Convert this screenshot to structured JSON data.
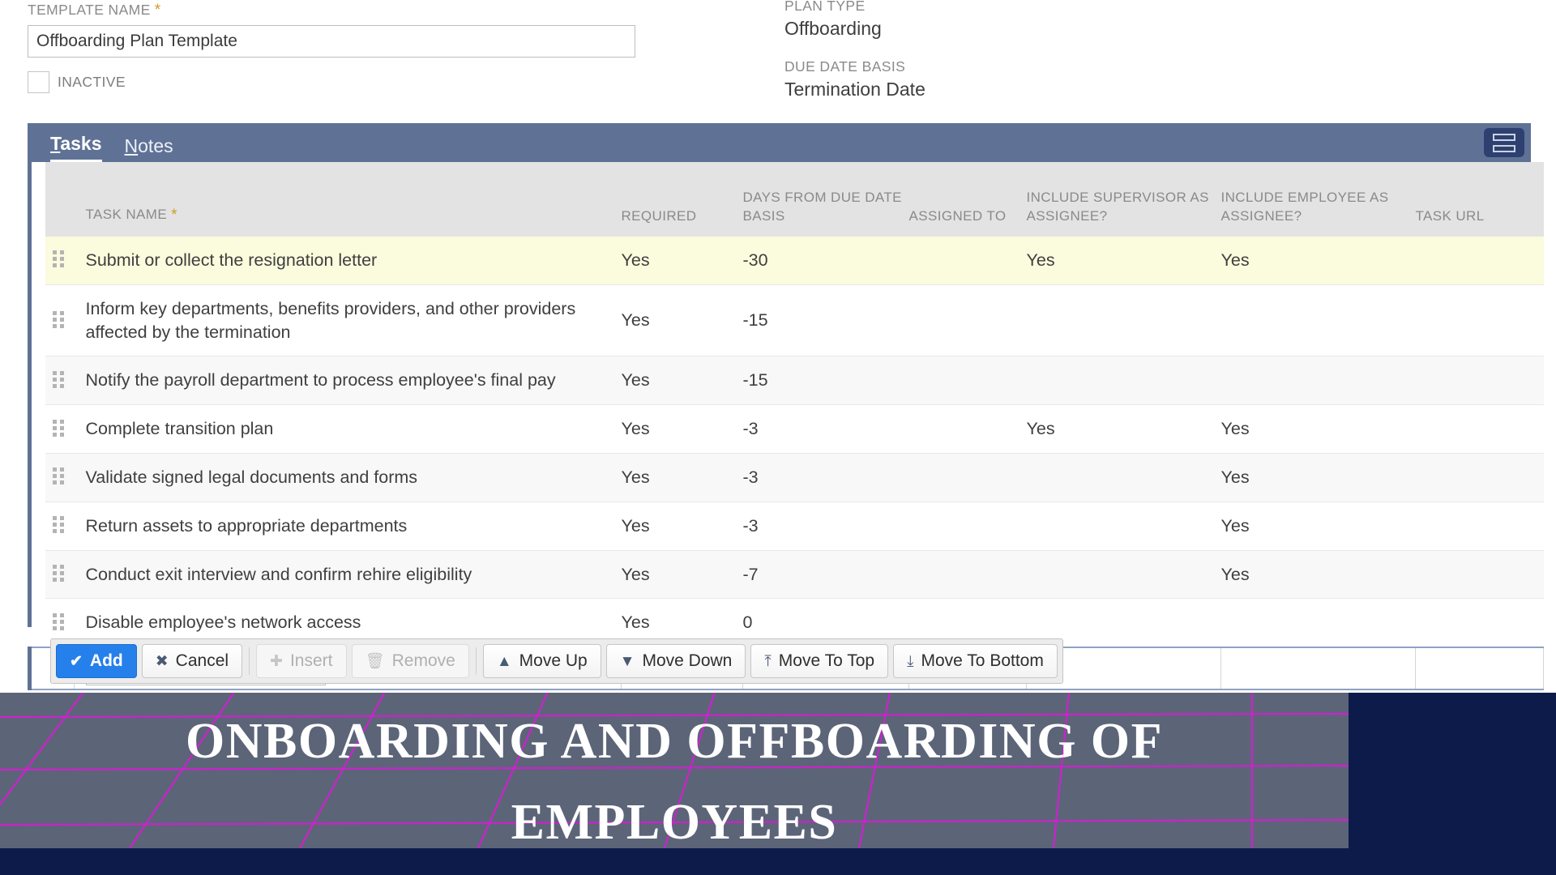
{
  "form": {
    "template_name": {
      "label": "TEMPLATE NAME",
      "required_marker": "*",
      "value": "Offboarding Plan Template",
      "placeholder": ""
    },
    "inactive": {
      "label": "INACTIVE",
      "checked": false
    },
    "plan_type": {
      "label": "PLAN TYPE",
      "value": "Offboarding"
    },
    "due_date_basis": {
      "label": "DUE DATE BASIS",
      "value": "Termination Date"
    }
  },
  "tabs": {
    "items": [
      {
        "label": "Tasks",
        "hotkey": "T",
        "rest": "asks",
        "active": true
      },
      {
        "label": "Notes",
        "hotkey": "N",
        "rest": "otes",
        "active": false
      }
    ],
    "view_toggle_icon": "split-view-icon"
  },
  "table": {
    "columns": [
      {
        "key": "handle",
        "label": ""
      },
      {
        "key": "name",
        "label": "TASK NAME",
        "required_marker": "*"
      },
      {
        "key": "required",
        "label": "REQUIRED"
      },
      {
        "key": "days",
        "label": "DAYS FROM DUE DATE BASIS"
      },
      {
        "key": "assigned_to",
        "label": "ASSIGNED TO"
      },
      {
        "key": "include_supervisor",
        "label": "INCLUDE SUPERVISOR AS ASSIGNEE?"
      },
      {
        "key": "include_employee",
        "label": "INCLUDE EMPLOYEE AS ASSIGNEE?"
      },
      {
        "key": "task_url",
        "label": "TASK URL"
      }
    ],
    "rows": [
      {
        "name": "Submit or collect the resignation letter",
        "required": "Yes",
        "days": "-30",
        "assigned_to": "",
        "include_supervisor": "Yes",
        "include_employee": "Yes",
        "task_url": "",
        "highlighted": true
      },
      {
        "name": "Inform key departments, benefits providers, and other providers affected by the termination",
        "required": "Yes",
        "days": "-15",
        "assigned_to": "",
        "include_supervisor": "",
        "include_employee": "",
        "task_url": "",
        "highlighted": false
      },
      {
        "name": "Notify the payroll department to process employee's final pay",
        "required": "Yes",
        "days": "-15",
        "assigned_to": "",
        "include_supervisor": "",
        "include_employee": "",
        "task_url": "",
        "highlighted": false
      },
      {
        "name": "Complete transition plan",
        "required": "Yes",
        "days": "-3",
        "assigned_to": "",
        "include_supervisor": "Yes",
        "include_employee": "Yes",
        "task_url": "",
        "highlighted": false
      },
      {
        "name": "Validate signed legal documents and forms",
        "required": "Yes",
        "days": "-3",
        "assigned_to": "",
        "include_supervisor": "",
        "include_employee": "Yes",
        "task_url": "",
        "highlighted": false
      },
      {
        "name": "Return assets to appropriate departments",
        "required": "Yes",
        "days": "-3",
        "assigned_to": "",
        "include_supervisor": "",
        "include_employee": "Yes",
        "task_url": "",
        "highlighted": false
      },
      {
        "name": "Conduct exit interview and confirm rehire eligibility",
        "required": "Yes",
        "days": "-7",
        "assigned_to": "",
        "include_supervisor": "",
        "include_employee": "Yes",
        "task_url": "",
        "highlighted": false
      },
      {
        "name": "Disable employee's network access",
        "required": "Yes",
        "days": "0",
        "assigned_to": "",
        "include_supervisor": "",
        "include_employee": "",
        "task_url": "",
        "highlighted": false
      }
    ],
    "new_row": {
      "name_value": "",
      "name_placeholder": ""
    }
  },
  "toolbar": {
    "buttons": [
      {
        "label": "Add",
        "icon": "check-icon",
        "glyph": "✔",
        "style": "primary",
        "disabled": false
      },
      {
        "label": "Cancel",
        "icon": "x-icon",
        "glyph": "✖",
        "style": "default",
        "disabled": false
      },
      {
        "label": "Insert",
        "icon": "plus-icon",
        "glyph": "✚",
        "style": "default",
        "disabled": true
      },
      {
        "label": "Remove",
        "icon": "trash-icon",
        "glyph": "🗑",
        "style": "default",
        "disabled": true
      },
      {
        "label": "Move Up",
        "icon": "arrow-up-icon",
        "glyph": "▲",
        "style": "default",
        "disabled": false
      },
      {
        "label": "Move Down",
        "icon": "arrow-down-icon",
        "glyph": "▼",
        "style": "default",
        "disabled": false
      },
      {
        "label": "Move To Top",
        "icon": "move-to-top-icon",
        "glyph": "⤒",
        "style": "default",
        "disabled": false
      },
      {
        "label": "Move To Bottom",
        "icon": "move-to-bottom-icon",
        "glyph": "⤓",
        "style": "default",
        "disabled": false
      }
    ]
  },
  "banner": {
    "title_line_1": "ONBOARDING AND OFFBOARDING OF",
    "title_line_2": "EMPLOYEES",
    "panel_color": "#5c6478",
    "edge_color": "#0d1b4b",
    "grid_color": "#cc22cc"
  },
  "colors": {
    "tab_bar": "#5f7296",
    "accent_blue": "#2680eb",
    "toggle_dark": "#2d4070",
    "required_star": "#d19a22",
    "row_highlight": "#fbfbdd",
    "header_gray": "#e3e3e3"
  }
}
